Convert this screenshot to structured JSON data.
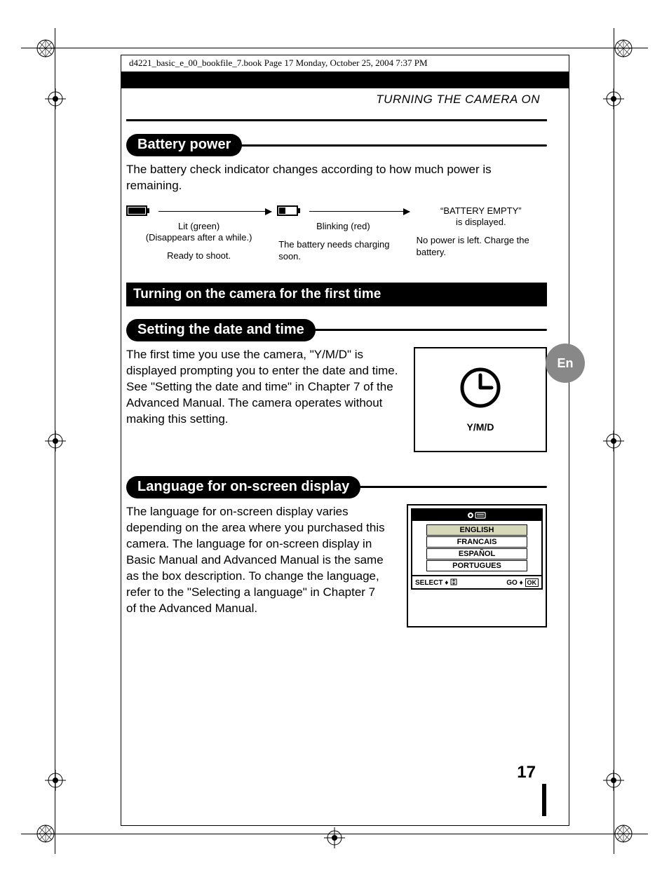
{
  "crop": {
    "book_info": "d4221_basic_e_00_bookfile_7.book  Page 17  Monday, October 25, 2004  7:37 PM"
  },
  "running_head": "TURNING THE CAMERA ON",
  "lang_tab": "En",
  "page_number": "17",
  "sections": {
    "battery": {
      "title": "Battery power",
      "intro": "The battery check indicator changes according to how much power is remaining.",
      "col1_status_line1": "Lit (green)",
      "col1_status_line2": "(Disappears after a while.)",
      "col1_desc": "Ready to shoot.",
      "col2_status": "Blinking (red)",
      "col2_desc": "The battery needs charging soon.",
      "col3_status_line1": "“BATTERY EMPTY”",
      "col3_status_line2": "is displayed.",
      "col3_desc": "No power is left. Charge the battery."
    },
    "first_time_bar": "Turning on the camera for the first time",
    "datetime": {
      "title": "Setting the date and time",
      "body": "The first time you use the camera, \"Y/M/D\" is displayed prompting you to enter the date and time. See \"Setting the date and time\" in Chapter 7 of the Advanced Manual. The camera operates without making this setting.",
      "ymd_label": "Y/M/D"
    },
    "language": {
      "title": "Language for on-screen display",
      "body": "The language for on-screen display varies depending on the area where you purchased this camera. The language for on-screen display in Basic Manual and Advanced Manual is the same as the box description. To change the language, refer to the \"Selecting a language\" in Chapter 7 of the Advanced Manual.",
      "options": {
        "en": "ENGLISH",
        "fr": "FRANCAIS",
        "es": "ESPAÑOL",
        "pt": "PORTUGUES"
      },
      "select_label": "SELECT",
      "go_label": "GO",
      "ok_label": "OK"
    }
  }
}
